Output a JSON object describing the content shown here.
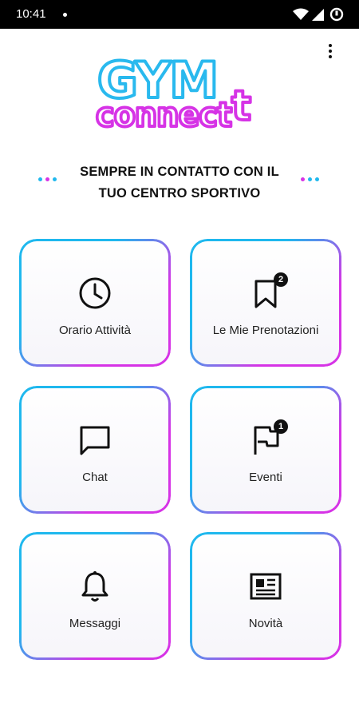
{
  "status_bar": {
    "time": "10:41"
  },
  "logo": {
    "line1": "GYM",
    "line1_accent": "t",
    "line2": "connect"
  },
  "tagline": {
    "line1": "SEMPRE IN CONTATTO CON IL",
    "line2": "TUO CENTRO SPORTIVO"
  },
  "colors": {
    "blue": "#1fb8ee",
    "magenta": "#d633e6"
  },
  "tiles": [
    {
      "label": "Orario Attività",
      "icon": "clock-icon"
    },
    {
      "label": "Le Mie Prenotazioni",
      "icon": "bookmark-icon",
      "badge": "2"
    },
    {
      "label": "Chat",
      "icon": "chat-icon"
    },
    {
      "label": "Eventi",
      "icon": "flag-icon",
      "badge": "1"
    },
    {
      "label": "Messaggi",
      "icon": "bell-icon"
    },
    {
      "label": "Novità",
      "icon": "newspaper-icon"
    }
  ]
}
